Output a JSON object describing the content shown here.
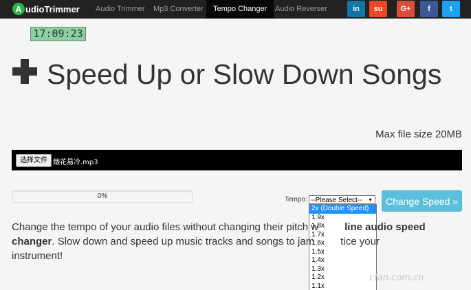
{
  "navbar": {
    "logo_letter": "A",
    "logo_text": "udioTrimmer",
    "items": [
      {
        "label": "Audio Trimmer"
      },
      {
        "label": "Mp3 Converter"
      },
      {
        "label": "Tempo Changer",
        "active": true
      },
      {
        "label": "Audio Reverser"
      }
    ],
    "social": [
      {
        "label": "in",
        "icon": "linkedin-icon",
        "color": "#0e76a8"
      },
      {
        "label": "su",
        "icon": "stumbleupon-icon",
        "color": "#eb4924"
      },
      {
        "label": "G+",
        "icon": "googleplus-icon",
        "color": "#dd4b39"
      },
      {
        "label": "f",
        "icon": "facebook-icon",
        "color": "#3b5998"
      },
      {
        "label": "t",
        "icon": "twitter-icon",
        "color": "#1da1f2"
      }
    ]
  },
  "clock": "17:09:23",
  "title": "Speed Up or Slow Down Songs",
  "max_file_size": "Max file size 20MB",
  "file": {
    "button_label": "选择文件",
    "file_name": "烟花易冷.mp3"
  },
  "progress": {
    "value": 0,
    "text": "0%"
  },
  "tempo": {
    "label": "Tempo:",
    "selected": "--Please Select--",
    "options": [
      "2x (Double Speed)",
      "1.9x",
      "1.8x",
      "1.7x",
      "1.6x",
      "1.5x",
      "1.4x",
      "1.3x",
      "1.2x",
      "1.1x"
    ],
    "highlighted_index": 0
  },
  "change_button": "Change Speed »",
  "description": {
    "line1_a": "Change the tempo of your audio files without changing their pitch w",
    "line1_b": "line audio speed",
    "line2_bold": "changer",
    "line2_a": ". Slow down and speed up music tracks and songs to jam",
    "line2_b": "tice your",
    "line3": "instrument!"
  },
  "watermark": "cfan.com.cn",
  "colors": {
    "navbar_bg": "#222222",
    "accent_button": "#5bc0de",
    "dropdown_highlight": "#1e90ff"
  }
}
